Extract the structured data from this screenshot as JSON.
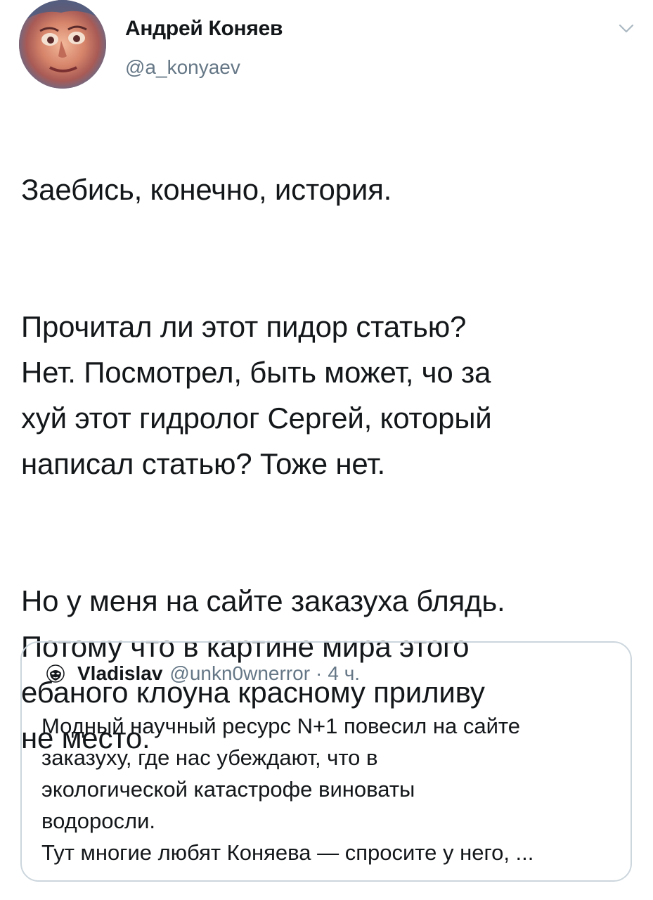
{
  "tweet": {
    "author_name": "Андрей Коняев",
    "author_handle": "@a_konyaev",
    "paragraphs": [
      "Заебись, конечно, история.",
      "Прочитал ли этот пидор статью?\nНет. Посмотрел, быть может, чо за\nхуй этот гидролог Сергей, который\nнаписал статью? Тоже нет.",
      "Но у меня на сайте заказуха блядь.\nПотому что в картине мира этого\nебаного клоуна красному приливу\nне место."
    ]
  },
  "quoted_tweet": {
    "author_name": "Vladislav",
    "author_handle": "@unkn0wnerror",
    "separator": "·",
    "time": "4 ч.",
    "text": "Модный научный ресурс N+1 повесил на сайте\nзаказуху, где нас убеждают, что в\nэкологической катастрофе виноваты\nводоросли.\nТут многие любят Коняева — спросите у него, ..."
  },
  "icons": {
    "more": "chevron-down-icon",
    "quoted_avatar": "anonymous-mask-icon"
  },
  "colors": {
    "text_primary": "#14171a",
    "text_secondary": "#657786",
    "border": "#ccd6dd"
  }
}
